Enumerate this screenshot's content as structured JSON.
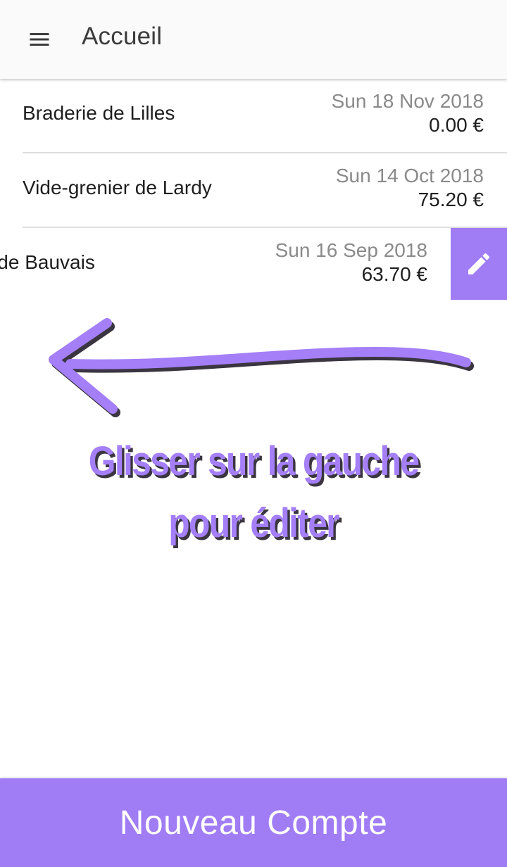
{
  "header": {
    "title": "Accueil",
    "menu_icon": "menu-icon"
  },
  "accounts": [
    {
      "name": "Braderie de Lilles",
      "date": "Sun 18 Nov 2018",
      "amount": "0.00 €"
    },
    {
      "name": "Vide-grenier de Lardy",
      "date": "Sun 14 Oct 2018",
      "amount": "75.20 €"
    },
    {
      "name": "Brocante de Bauvais",
      "date": "Sun 16 Sep 2018",
      "amount": "63.70 €",
      "visible_name": "cante de Bauvais",
      "swiped": true,
      "action_icon": "pencil-icon"
    }
  ],
  "hint": {
    "line1": "Glisser sur la gauche",
    "line2": "pour éditer",
    "arrow_icon": "arrow-left-icon"
  },
  "footer": {
    "button_label": "Nouveau Compte"
  },
  "colors": {
    "accent": "#a07cf5",
    "header_bg": "#fafafa",
    "secondary_text": "#8a8a8a",
    "hint_shadow": "#3a3540"
  }
}
